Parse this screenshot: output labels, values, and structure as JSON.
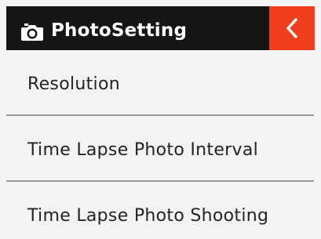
{
  "header": {
    "title": "PhotoSetting",
    "camera_icon": "camera-icon",
    "back_icon": "chevron-left-icon"
  },
  "menu": {
    "items": [
      {
        "label": "Resolution"
      },
      {
        "label": "Time Lapse Photo Interval"
      },
      {
        "label": "Time Lapse Photo Shooting"
      }
    ]
  },
  "colors": {
    "header_background": "#161616",
    "back_button_background": "#ef3d1e",
    "screen_background": "#f3f3f3",
    "divider": "#9b9b9b",
    "text": "#232323"
  }
}
